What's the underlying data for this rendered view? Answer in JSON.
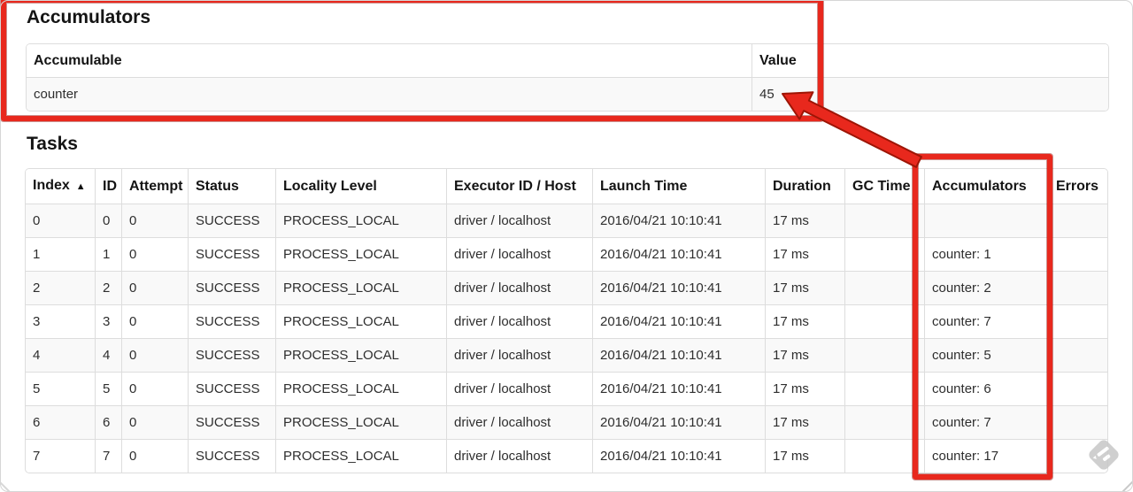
{
  "accumulators": {
    "title": "Accumulators",
    "headers": {
      "accumulable": "Accumulable",
      "value": "Value"
    },
    "rows": [
      {
        "accumulable": "counter",
        "value": "45"
      }
    ]
  },
  "tasks": {
    "title": "Tasks",
    "sort_indicator": "▲",
    "headers": {
      "index": "Index",
      "id": "ID",
      "attempt": "Attempt",
      "status": "Status",
      "locality": "Locality Level",
      "executor": "Executor ID / Host",
      "launch": "Launch Time",
      "duration": "Duration",
      "gc": "GC Time",
      "accumulators": "Accumulators",
      "errors": "Errors"
    },
    "rows": [
      {
        "index": "0",
        "id": "0",
        "attempt": "0",
        "status": "SUCCESS",
        "locality": "PROCESS_LOCAL",
        "executor": "driver / localhost",
        "launch": "2016/04/21 10:10:41",
        "duration": "17 ms",
        "gc": "",
        "accum": "",
        "errors": ""
      },
      {
        "index": "1",
        "id": "1",
        "attempt": "0",
        "status": "SUCCESS",
        "locality": "PROCESS_LOCAL",
        "executor": "driver / localhost",
        "launch": "2016/04/21 10:10:41",
        "duration": "17 ms",
        "gc": "",
        "accum": "counter: 1",
        "errors": ""
      },
      {
        "index": "2",
        "id": "2",
        "attempt": "0",
        "status": "SUCCESS",
        "locality": "PROCESS_LOCAL",
        "executor": "driver / localhost",
        "launch": "2016/04/21 10:10:41",
        "duration": "17 ms",
        "gc": "",
        "accum": "counter: 2",
        "errors": ""
      },
      {
        "index": "3",
        "id": "3",
        "attempt": "0",
        "status": "SUCCESS",
        "locality": "PROCESS_LOCAL",
        "executor": "driver / localhost",
        "launch": "2016/04/21 10:10:41",
        "duration": "17 ms",
        "gc": "",
        "accum": "counter: 7",
        "errors": ""
      },
      {
        "index": "4",
        "id": "4",
        "attempt": "0",
        "status": "SUCCESS",
        "locality": "PROCESS_LOCAL",
        "executor": "driver / localhost",
        "launch": "2016/04/21 10:10:41",
        "duration": "17 ms",
        "gc": "",
        "accum": "counter: 5",
        "errors": ""
      },
      {
        "index": "5",
        "id": "5",
        "attempt": "0",
        "status": "SUCCESS",
        "locality": "PROCESS_LOCAL",
        "executor": "driver / localhost",
        "launch": "2016/04/21 10:10:41",
        "duration": "17 ms",
        "gc": "",
        "accum": "counter: 6",
        "errors": ""
      },
      {
        "index": "6",
        "id": "6",
        "attempt": "0",
        "status": "SUCCESS",
        "locality": "PROCESS_LOCAL",
        "executor": "driver / localhost",
        "launch": "2016/04/21 10:10:41",
        "duration": "17 ms",
        "gc": "",
        "accum": "counter: 7",
        "errors": ""
      },
      {
        "index": "7",
        "id": "7",
        "attempt": "0",
        "status": "SUCCESS",
        "locality": "PROCESS_LOCAL",
        "executor": "driver / localhost",
        "launch": "2016/04/21 10:10:41",
        "duration": "17 ms",
        "gc": "",
        "accum": "counter: 17",
        "errors": ""
      }
    ]
  },
  "annotations": {
    "accent_color": "#e8281d",
    "box_labels": [
      "accumulators-section-highlight",
      "accumulators-column-highlight"
    ]
  }
}
